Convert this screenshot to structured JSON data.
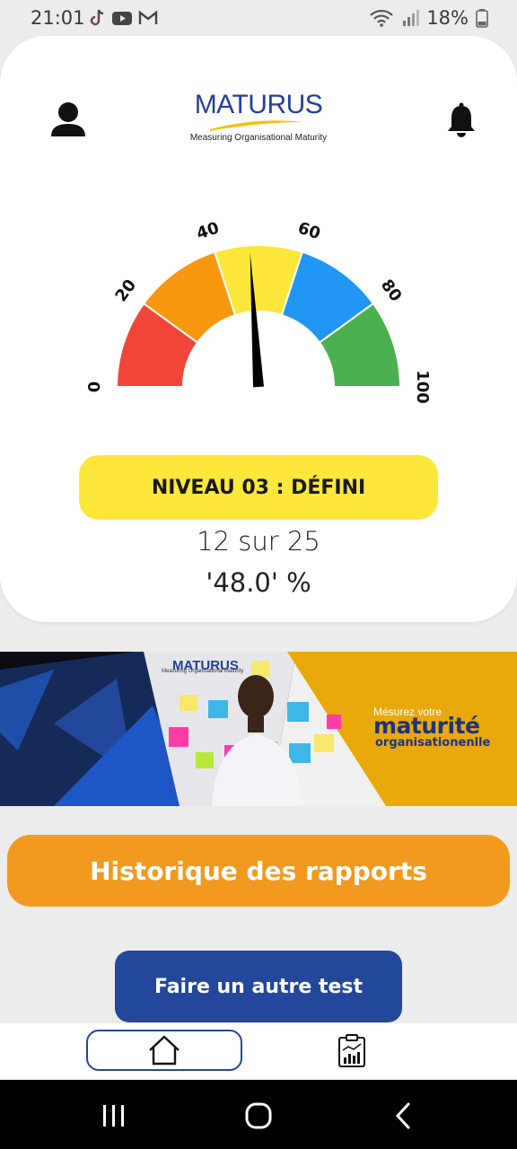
{
  "status_bar": {
    "time": "21:01",
    "battery_pct": "18%",
    "icons": [
      "tiktok-icon",
      "youtube-icon",
      "gmail-icon",
      "wifi-icon",
      "signal-icon",
      "battery-icon"
    ]
  },
  "header": {
    "logo_text": "MATURUS",
    "logo_subtitle": "Measuring Organisational Maturity",
    "profile_icon": "user-icon",
    "notification_icon": "bell-icon"
  },
  "gauge": {
    "ticks": [
      "0",
      "20",
      "40",
      "60",
      "80",
      "100"
    ],
    "value_pct": 48.0,
    "segment_colors": [
      "#f1453a",
      "#f7980f",
      "#fde73a",
      "#2196f3",
      "#4caf50"
    ]
  },
  "level": {
    "label": "NIVEAU 03 : DÉFINI",
    "color": "#fde73a"
  },
  "score": {
    "text": "12 sur 25",
    "percent_text": "'48.0' %"
  },
  "banner": {
    "logo": "MATURUS",
    "logo_subtitle": "Measuring Organisational Maturity",
    "line1": "Mésurez votre",
    "line2": "maturité",
    "line3": "organisationenlle"
  },
  "actions": {
    "history_label": "Historique des rapports",
    "history_color": "#f29a1f",
    "test_label": "Faire un autre test",
    "test_color": "#23479a"
  },
  "bottom_nav": {
    "items": [
      {
        "icon": "home-icon",
        "active": true
      },
      {
        "icon": "report-chart-icon",
        "active": false
      }
    ]
  },
  "system_nav": {
    "buttons": [
      "recent-apps-icon",
      "home-circle-icon",
      "back-icon"
    ]
  }
}
